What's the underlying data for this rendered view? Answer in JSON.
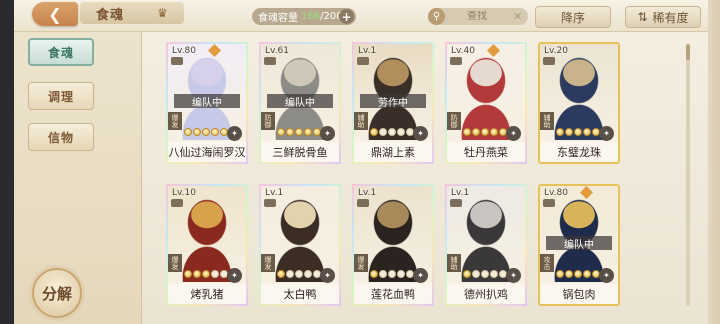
{
  "header": {
    "title": "食魂",
    "capacity_label": "食魂容量",
    "capacity_count": "166",
    "capacity_total": "/200",
    "search_placeholder": "查找",
    "sort_desc_label": "降序",
    "sort_rarity_label": "稀有度"
  },
  "sidebar": {
    "tabs": [
      {
        "label": "食魂",
        "active": true
      },
      {
        "label": "调理",
        "active": false
      },
      {
        "label": "信物",
        "active": false
      }
    ],
    "decompose_label": "分解"
  },
  "cards": [
    {
      "level": "Lv.80",
      "name": "八仙过海闹罗汉",
      "status": "编队中",
      "role": "爆发",
      "full": true,
      "stars": 5,
      "frame": "rainbow",
      "palette": [
        "#c7c9e8",
        "#d7d0ea",
        "#f1edf6"
      ]
    },
    {
      "level": "Lv.61",
      "name": "三鲜脱骨鱼",
      "status": "编队中",
      "role": "防御",
      "full": false,
      "stars": 5,
      "frame": "rainbow",
      "palette": [
        "#8d8b86",
        "#cfc8b9",
        "#efe7d7"
      ]
    },
    {
      "level": "Lv.1",
      "name": "鼎湖上素",
      "status": "劳作中",
      "role": "辅助",
      "full": false,
      "stars": 1,
      "frame": "rainbow",
      "palette": [
        "#3a2f28",
        "#b08f5c",
        "#e9dcc4"
      ]
    },
    {
      "level": "Lv.40",
      "name": "牡丹燕菜",
      "status": "",
      "role": "防御",
      "full": true,
      "stars": 5,
      "frame": "rainbow",
      "palette": [
        "#b33a3a",
        "#e6d9cf",
        "#f5efe6"
      ]
    },
    {
      "level": "Lv.20",
      "name": "东璧龙珠",
      "status": "",
      "role": "辅助",
      "full": false,
      "stars": 5,
      "frame": "gold",
      "palette": [
        "#2b3a5e",
        "#c9b38b",
        "#ece4d2"
      ]
    },
    {
      "level": "Lv.10",
      "name": "烤乳猪",
      "status": "",
      "role": "爆发",
      "full": false,
      "stars": 3,
      "frame": "rainbow",
      "palette": [
        "#8a2a1e",
        "#d8a24a",
        "#efe4cc"
      ]
    },
    {
      "level": "Lv.1",
      "name": "太白鸭",
      "status": "",
      "role": "爆发",
      "full": false,
      "stars": 1,
      "frame": "rainbow",
      "palette": [
        "#3b2d24",
        "#e2d2ae",
        "#f4ede0"
      ]
    },
    {
      "level": "Lv.1",
      "name": "莲花血鸭",
      "status": "",
      "role": "爆发",
      "full": false,
      "stars": 1,
      "frame": "rainbow",
      "palette": [
        "#2a2320",
        "#a88a5a",
        "#ece2cd"
      ]
    },
    {
      "level": "Lv.1",
      "name": "德州扒鸡",
      "status": "",
      "role": "辅助",
      "full": false,
      "stars": 1,
      "frame": "rainbow",
      "palette": [
        "#3a3838",
        "#c8c4c0",
        "#eeeae4"
      ]
    },
    {
      "level": "Lv.80",
      "name": "锅包肉",
      "status": "编队中",
      "role": "攻击",
      "full": true,
      "stars": 5,
      "frame": "gold",
      "palette": [
        "#1f2b4a",
        "#d7b45a",
        "#f3ead6"
      ]
    }
  ]
}
